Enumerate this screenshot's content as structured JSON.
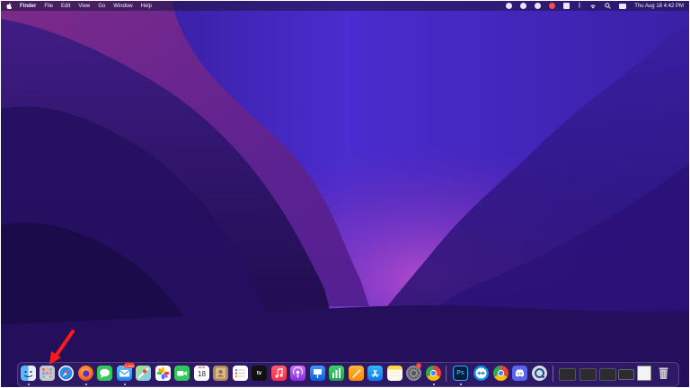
{
  "menubar": {
    "app_name": "Finder",
    "menus": [
      "File",
      "Edit",
      "View",
      "Go",
      "Window",
      "Help"
    ],
    "clock": "Thu Aug 18  4:42 PM",
    "status_icons": [
      "screen-capture-icon",
      "circle-icon",
      "app-status-icon",
      "vpn-icon",
      "clipboard-icon",
      "bluetooth-icon",
      "wifi-icon",
      "search-icon",
      "control-center-icon",
      "battery-icon"
    ]
  },
  "dock": {
    "apps": [
      {
        "name": "Finder",
        "icon": "finder-icon"
      },
      {
        "name": "Launchpad",
        "icon": "launchpad-icon"
      },
      {
        "name": "Safari",
        "icon": "safari-icon"
      },
      {
        "name": "Firefox",
        "icon": "firefox-icon"
      },
      {
        "name": "Messages",
        "icon": "messages-icon"
      },
      {
        "name": "Mail",
        "icon": "mail-icon",
        "badge": "1,464"
      },
      {
        "name": "Maps",
        "icon": "maps-icon"
      },
      {
        "name": "Photos",
        "icon": "photos-icon"
      },
      {
        "name": "FaceTime",
        "icon": "facetime-icon"
      },
      {
        "name": "Calendar",
        "icon": "calendar-icon",
        "month": "AUG",
        "day": "18"
      },
      {
        "name": "Contacts",
        "icon": "contacts-icon"
      },
      {
        "name": "Reminders",
        "icon": "reminders-icon"
      },
      {
        "name": "TV",
        "icon": "tv-icon",
        "label": "tv"
      },
      {
        "name": "Music",
        "icon": "music-icon"
      },
      {
        "name": "Podcasts",
        "icon": "podcasts-icon"
      },
      {
        "name": "Keynote",
        "icon": "keynote-icon"
      },
      {
        "name": "Numbers",
        "icon": "numbers-icon"
      },
      {
        "name": "Pages",
        "icon": "pages-icon"
      },
      {
        "name": "App Store",
        "icon": "app-store-icon"
      },
      {
        "name": "Notes",
        "icon": "notes-icon"
      },
      {
        "name": "System Preferences",
        "icon": "system-preferences-icon",
        "badge": "1"
      },
      {
        "name": "Google Chrome",
        "icon": "chrome-icon"
      },
      {
        "name": "Photoshop",
        "icon": "photoshop-icon",
        "label": "Ps"
      },
      {
        "name": "TeamViewer",
        "icon": "teamviewer-icon"
      },
      {
        "name": "Google Chrome",
        "icon": "chrome-icon-2"
      },
      {
        "name": "Discord",
        "icon": "discord-icon"
      },
      {
        "name": "QuickTime Player",
        "icon": "quicktime-icon"
      },
      {
        "name": "Minimized window 1",
        "icon": "window-thumbnail-icon"
      },
      {
        "name": "Minimized window 2",
        "icon": "window-thumbnail-icon"
      },
      {
        "name": "Minimized window 3",
        "icon": "window-thumbnail-icon"
      },
      {
        "name": "Minimized window 4",
        "icon": "window-thumbnail-icon"
      },
      {
        "name": "Minimized window 5",
        "icon": "window-thumbnail-icon"
      },
      {
        "name": "Trash",
        "icon": "trash-icon"
      }
    ]
  },
  "annotation": {
    "icon": "red-arrow-icon",
    "color": "#ff1a1a"
  },
  "colors": {
    "wallpaper_top": "#3b1f9b",
    "wallpaper_glow": "#b245c8",
    "menubar_text": "#f2f0ff"
  }
}
